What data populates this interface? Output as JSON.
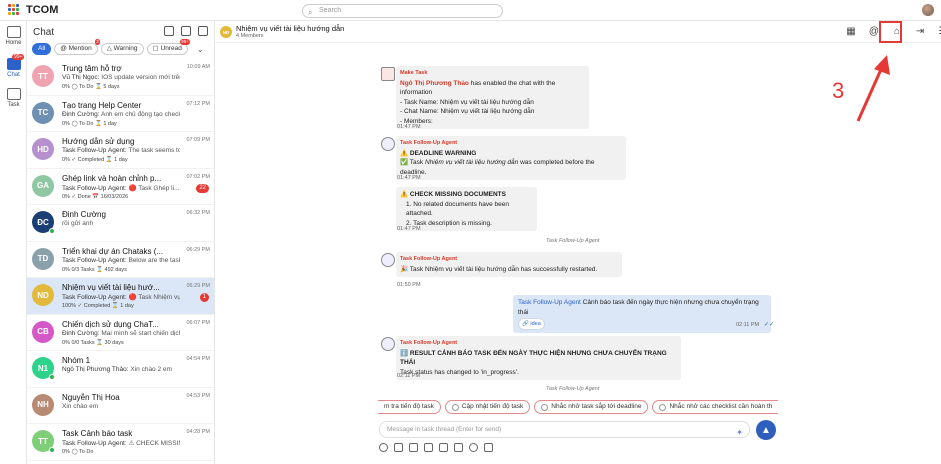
{
  "app": {
    "name": "TCOM",
    "search_placeholder": "Search"
  },
  "rail": [
    {
      "label": "Home",
      "icon": "home-icon"
    },
    {
      "label": "Chat",
      "icon": "chat-icon",
      "badge": "99+"
    },
    {
      "label": "Task",
      "icon": "task-icon"
    }
  ],
  "chat_panel": {
    "title": "Chat",
    "filters": [
      {
        "label": "All"
      },
      {
        "label": "Mention",
        "count": "3"
      },
      {
        "label": "Warning"
      },
      {
        "label": "Unread",
        "count": "99+"
      }
    ],
    "items": [
      {
        "initials": "TT",
        "color": "#f0a3b0",
        "name": "Trung tâm hỗ trợ",
        "time": "10:09 AM",
        "sender": "Vũ Thị Ngọc:",
        "preview": "IOS update version mới trên stor...",
        "meta": "0%  ◯ To Do  ⌛ 5 days"
      },
      {
        "initials": "TC",
        "color": "#6f8fb3",
        "name": "Tạo trang Help Center",
        "time": "07:12 PM",
        "sender": "Đinh Cường:",
        "preview": "Anh em chủ động tạo checklist it...",
        "meta": "0%  ◯ To Do  ⌛ 1 day"
      },
      {
        "initials": "HD",
        "color": "#b68fcf",
        "name": "Hướng dẫn sử dụng",
        "time": "07:09 PM",
        "sender": "Task Follow-Up Agent:",
        "preview": "The task seems to be ...",
        "meta": "0%  ✓ Completed  ⌛ 1 day"
      },
      {
        "initials": "GA",
        "color": "#8fc7a2",
        "name": "Ghép link và hoàn chỉnh p...",
        "time": "07:02 PM",
        "sender": "Task Follow-Up Agent:",
        "preview": "🔴 Task Ghép li...",
        "meta": "0%  ✓ Done  📅 16/03/2026",
        "badge": "22"
      },
      {
        "initials": "ĐC",
        "color": "#1b3e74",
        "name": "Đinh Cường",
        "time": "06:32 PM",
        "sender": "",
        "preview": "rồi gửi anh",
        "meta": ""
      },
      {
        "initials": "TD",
        "color": "#8aa0ab",
        "name": "Triển khai dự án Chataks (...",
        "time": "06:29 PM",
        "sender": "Task Follow-Up Agent:",
        "preview": "Below are the tasks awa...",
        "meta": "0%  0/3 Tasks  ⌛ 492 days"
      },
      {
        "initials": "ND",
        "color": "#e2b93b",
        "name": "Nhiệm vụ viết tài liệu hướ...",
        "time": "06:29 PM",
        "sender": "Task Follow-Up Agent:",
        "preview": "🔴 Task Nhiệm vụ v...",
        "meta": "100%  ✓ Completed  ⌛ 1 day",
        "badge": "1"
      },
      {
        "initials": "CB",
        "color": "#d458c7",
        "name": "Chiến dịch sử dụng ChaT...",
        "time": "06:07 PM",
        "sender": "Đinh Cường:",
        "preview": "Mai mình sẽ start chiến dịch nhé",
        "meta": "0%  0/0 Tasks  ⌛ 30 days"
      },
      {
        "initials": "N1",
        "color": "#2dd38a",
        "name": "Nhóm 1",
        "time": "04:54 PM",
        "sender": "Ngô Thị Phương Thảo:",
        "preview": "Xin chào 2 em",
        "meta": ""
      },
      {
        "initials": "NH",
        "color": "#b98a73",
        "name": "Nguyễn Thị Hoa",
        "time": "04:53 PM",
        "sender": "",
        "preview": "Xin chào em",
        "meta": ""
      },
      {
        "initials": "TT",
        "color": "#7fcf78",
        "name": "Task Cảnh báo task",
        "time": "04:28 PM",
        "sender": "Task Follow-Up Agent:",
        "preview": "⚠ CHECK MISSING ...",
        "meta": "0%  ◯ To Do"
      }
    ]
  },
  "thread": {
    "title": "Nhiệm vụ viết tài liệu hướng dẫn",
    "avatar": "ND",
    "members": "4 Members",
    "messages": {
      "m1_sender": "Make Task",
      "m1_author": "Ngô Thị Phương Thảo",
      "m1_text": " has enabled the chat with the information",
      "m1_l1": "- Task Name: Nhiệm vụ viết tài liệu hướng dẫn",
      "m1_l2": "- Chat Name: Nhiệm vụ viết tài liệu hướng dẫn",
      "m1_l3": "- Members:",
      "m1_time": "01:47 PM",
      "m2_sender": "Task Follow-Up Agent",
      "m2_title": "⚠️ DEADLINE WARNING",
      "m2_l1a": "✅ Task ",
      "m2_l1b": "Nhiệm vụ viết tài liệu hướng dẫn",
      "m2_l1c": " was completed before the deadline.",
      "m2_time": "01:47 PM",
      "m3_title": "⚠️ CHECK MISSING DOCUMENTS",
      "m3_l1": "1. No related documents have been attached.",
      "m3_l2": "2. Task description is missing.",
      "m3_time": "01:47 PM",
      "sys1": "Task Follow-Up Agent",
      "m4_sender": "Task Follow-Up Agent",
      "m4_text": "🎉 Task Nhiệm vụ viết tài liệu hướng dẫn has successfully restarted.",
      "m4_time": "01:50 PM",
      "mine_agent": "Task Follow-Up Agent",
      "mine_text": " Cảnh báo task đến ngày thực hiện nhưng chưa chuyển trạng thái",
      "mine_tag": "🔗 idea",
      "mine_time": "02:11 PM",
      "m5_sender": "Task Follow-Up Agent",
      "m5_title": "ℹ️ RESULT CẢNH BÁO TASK ĐẾN NGÀY THỰC HIỆN NHƯNG CHƯA CHUYỂN TRẠNG THÁI",
      "m5_text": "Task status has changed to 'in_progress'.",
      "m5_time": "02:11 PM",
      "sys2": "Task Follow-Up Agent"
    },
    "suggestions": [
      "m tra tiến độ task",
      "Cập nhật tiến độ task",
      "Nhắc nhở task sắp tới deadline",
      "Nhắc nhở các checklist cần hoàn th"
    ],
    "composer_placeholder": "Message in task thread (Enter for send)"
  },
  "annotation": {
    "label": "3",
    "color": "#e53935"
  }
}
